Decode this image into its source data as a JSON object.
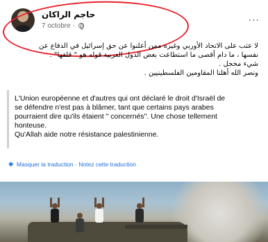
{
  "post": {
    "author": "حاجم الراكان",
    "date": "7 octobre",
    "separator": "·",
    "more_label": "...",
    "arabic_lines": [
      "لا عتب على الاتحاد الأوربي وغيره ممن أعلنوا عن حق إسرائيل في الدفاع عن",
      "نفسها ، ما دام أقصى ما استطاعت بعض الدول العربية قوله هو \" قلقها\" .",
      "شيء مخجل .",
      "ونصر الله أهلنا المقاومين الفلسطينيين ."
    ],
    "translation_lines": [
      "L'Union européenne et d'autres qui ont déclaré le droit d'Israël de",
      "se défendre n'est pas à blâmer, tant que certains pays arabes",
      "pourraient dire qu'ils étaient \" concernés\". Une chose tellement",
      "honteuse.",
      "Qu'Allah aide notre résistance palestinienne."
    ],
    "hide_translation": "Masquer la traduction",
    "links_separator": "·",
    "rate_translation": "Notez cette traduction"
  },
  "icons": {
    "privacy": "globe-icon",
    "more": "more-icon",
    "translation": "gear-icon"
  },
  "colors": {
    "annotation": "#e8202a",
    "link": "#216fdb",
    "secondary_text": "#65676b"
  }
}
